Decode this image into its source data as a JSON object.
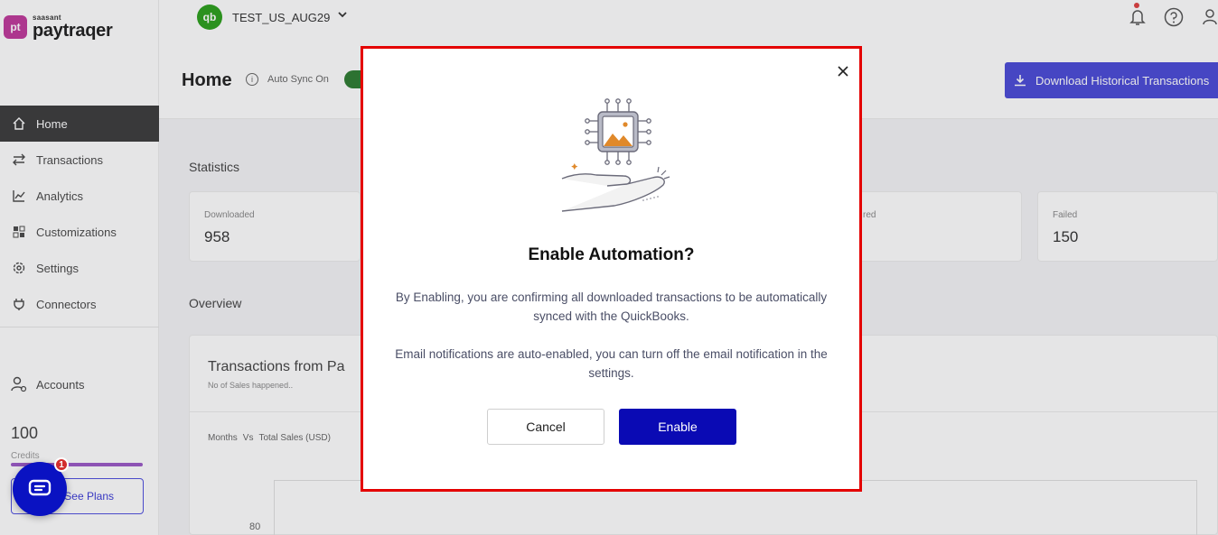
{
  "brand": {
    "small": "saasant",
    "name": "paytraqer",
    "mark": "pt"
  },
  "header": {
    "company": "TEST_US_AUG29",
    "page_title": "Home",
    "sync_label": "Auto Sync On",
    "download_button": "Download Historical Transactions"
  },
  "sidebar": {
    "items": [
      {
        "label": "Home",
        "icon": "home-icon"
      },
      {
        "label": "Transactions",
        "icon": "transfer-icon"
      },
      {
        "label": "Analytics",
        "icon": "chart-icon"
      },
      {
        "label": "Customizations",
        "icon": "grid-icon"
      },
      {
        "label": "Settings",
        "icon": "gear-icon"
      },
      {
        "label": "Connectors",
        "icon": "plug-icon"
      }
    ],
    "accounts": "Accounts",
    "credits_value": "100",
    "credits_label": "Credits",
    "credits_fill": 1.0,
    "plans_button": "See Plans",
    "chat_badge": "1"
  },
  "dashboard": {
    "statistics_label": "Statistics",
    "stats": [
      {
        "label": "Downloaded",
        "value": "958"
      },
      {
        "label": "red",
        "value": ""
      },
      {
        "label": "Failed",
        "value": "150"
      }
    ],
    "overview_label": "Overview",
    "overview_title": "Transactions from Pa",
    "overview_sub": "No of Sales happened..",
    "legend_months": "Months",
    "legend_vs": "Vs",
    "legend_sales": "Total Sales (USD)",
    "y_tick": "80"
  },
  "modal": {
    "title": "Enable Automation?",
    "paragraph1": "By Enabling, you are confirming all downloaded transactions to be automatically synced with the QuickBooks.",
    "paragraph2": "Email notifications are auto-enabled, you can turn off the email notification in the settings.",
    "cancel_button": "Cancel",
    "enable_button": "Enable",
    "accent_color": "#0a0ab4",
    "highlight_border": "#e40000"
  }
}
